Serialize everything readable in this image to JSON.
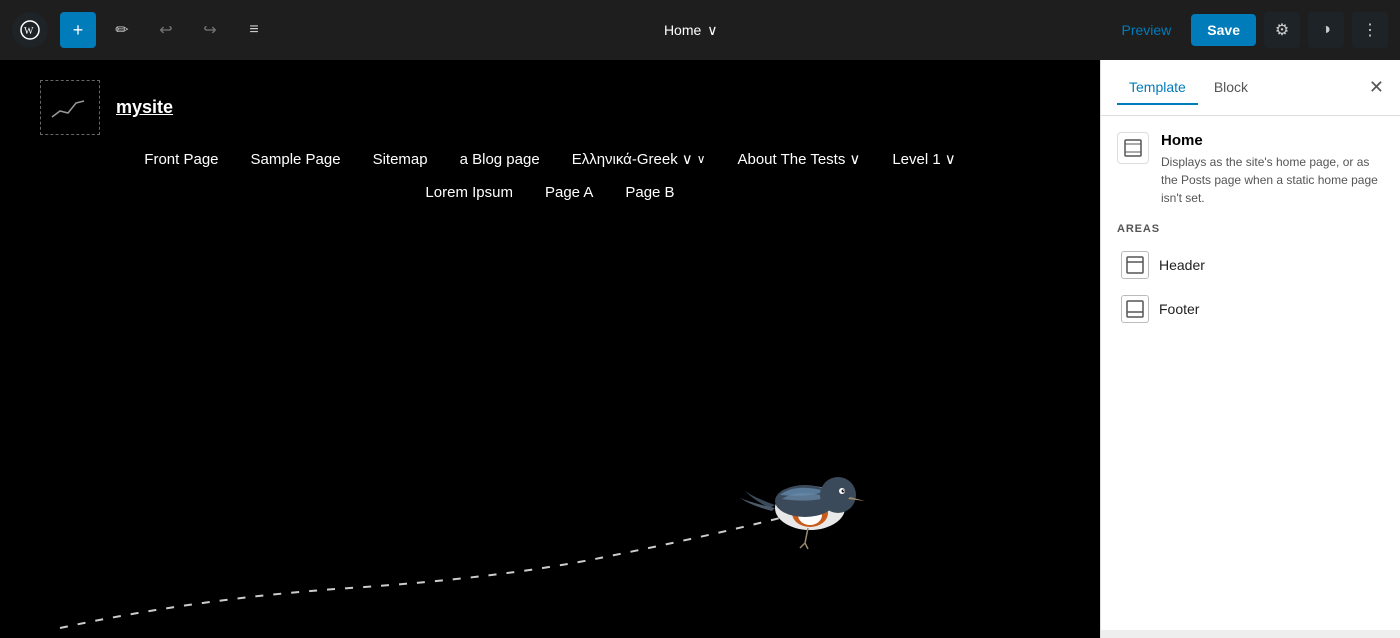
{
  "toolbar": {
    "add_label": "+",
    "edit_label": "✏",
    "undo_label": "↩",
    "redo_label": "↪",
    "list_label": "≡",
    "page_title": "Home",
    "page_title_arrow": "∨",
    "preview_label": "Preview",
    "save_label": "Save",
    "settings_icon": "⚙",
    "contrast_icon": "◑",
    "more_icon": "⋮"
  },
  "canvas": {
    "site_name": "mysite",
    "nav_row1": [
      {
        "label": "Front Page",
        "has_arrow": false
      },
      {
        "label": "Sample Page",
        "has_arrow": false
      },
      {
        "label": "Sitemap",
        "has_arrow": false
      },
      {
        "label": "a Blog page",
        "has_arrow": false
      },
      {
        "label": "Ελληνικά-Greek",
        "has_arrow": true
      },
      {
        "label": "About The Tests",
        "has_arrow": true
      },
      {
        "label": "Level 1",
        "has_arrow": true
      }
    ],
    "nav_row2": [
      {
        "label": "Lorem Ipsum",
        "has_arrow": false
      },
      {
        "label": "Page A",
        "has_arrow": false
      },
      {
        "label": "Page B",
        "has_arrow": false
      }
    ]
  },
  "right_panel": {
    "tab_template": "Template",
    "tab_block": "Block",
    "active_tab": "template",
    "home": {
      "title": "Home",
      "description": "Displays as the site's home page, or as the Posts page when a static home page isn't set."
    },
    "areas_label": "AREAS",
    "areas": [
      {
        "label": "Header",
        "icon": "header"
      },
      {
        "label": "Footer",
        "icon": "footer"
      }
    ]
  }
}
